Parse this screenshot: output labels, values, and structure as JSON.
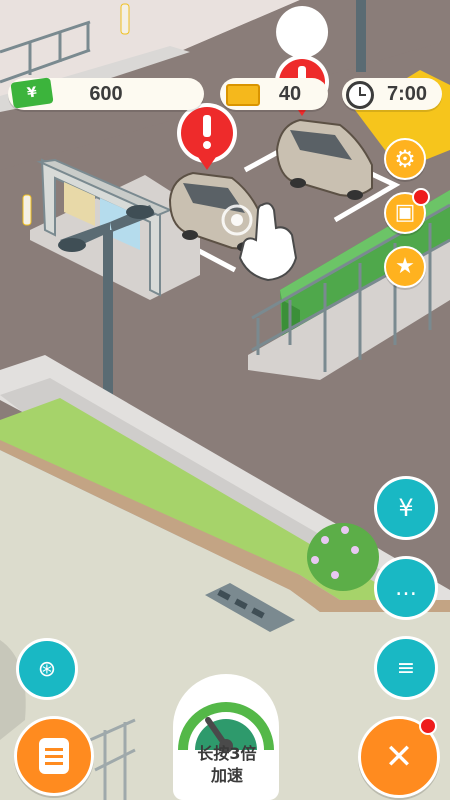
{
  "hud": {
    "cash": {
      "value": "600",
      "icon": "cash-bill-icon",
      "color": "#3cb43c"
    },
    "gold": {
      "value": "40",
      "icon": "gold-bar-icon",
      "color": "#f5b81c"
    },
    "clock": {
      "value": "7:00",
      "icon": "clock-icon"
    }
  },
  "side_buttons": {
    "settings": {
      "icon": "gear-icon"
    },
    "gift": {
      "icon": "gift-icon",
      "has_badge": true
    },
    "favorite": {
      "icon": "star-icon"
    }
  },
  "right_buttons": {
    "shop": {
      "icon": "money-bag-icon"
    },
    "chat": {
      "icon": "speech-bubble-icon"
    },
    "messages": {
      "icon": "message-icon"
    },
    "build": {
      "icon": "wrench-screwdriver-icon",
      "has_badge": true
    }
  },
  "left_buttons": {
    "video": {
      "icon": "film-reel-icon"
    },
    "menu": {
      "icon": "list-icon"
    }
  },
  "speed_button": {
    "line1": "长按3倍",
    "line2": "加速",
    "icon": "speedometer-icon"
  },
  "scene": {
    "cars": [
      {
        "icon": "car-icon",
        "alert": true
      },
      {
        "icon": "car-icon",
        "alert": true
      }
    ],
    "tap_hint": {
      "icon": "hand-pointer-icon"
    }
  },
  "colors": {
    "ground": "#8a7d79",
    "grass": "#a6d36a",
    "teal": "#19b8c4",
    "orange": "#ff8b1f",
    "alert_red": "#ee2b2b"
  }
}
